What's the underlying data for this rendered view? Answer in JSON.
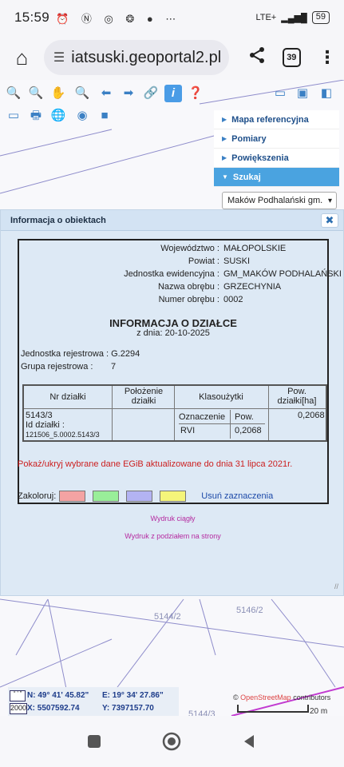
{
  "status_bar": {
    "time": "15:59",
    "battery": "59",
    "network": "LTE+"
  },
  "browser": {
    "url": "iatsuski.geoportal2.pl",
    "tab_count": "39"
  },
  "side_menu": {
    "items": [
      {
        "label": "Mapa referencyjna"
      },
      {
        "label": "Pomiary"
      },
      {
        "label": "Powiększenia"
      },
      {
        "label": "Szukaj"
      }
    ],
    "gmina_select": "Maków Podhalański gm."
  },
  "panel": {
    "title": "Informacja o obiektach",
    "close": "✖"
  },
  "parcel": {
    "fields": [
      {
        "label": "Województwo :",
        "value": "MAŁOPOLSKIE"
      },
      {
        "label": "Powiat :",
        "value": "SUSKI"
      },
      {
        "label": "Jednostka ewidencyjna :",
        "value": "GM_MAKÓW PODHALAŃSKI"
      },
      {
        "label": "Nazwa obrębu :",
        "value": "GRZECHYNIA"
      },
      {
        "label": "Numer obrębu :",
        "value": "0002"
      }
    ],
    "heading": "INFORMACJA O DZIAŁCE",
    "date_line": "z dnia: 20-10-2025",
    "jr_label": "Jednostka rejestrowa :",
    "jr_value": "G.2294",
    "gr_label": "Grupa rejestrowa :",
    "gr_value": "7",
    "table": {
      "headers": {
        "nr": "Nr działki",
        "polozenie": "Położenie działki",
        "klasouzytki": "Klasoużytki",
        "pow": "Pow. działki[ha]"
      },
      "sub_headers": {
        "oznaczenie": "Oznaczenie",
        "pow": "Pow."
      },
      "row": {
        "nr": "5143/3",
        "id_label": "Id działki :",
        "id_value": "121506_5.0002.5143/3",
        "oznaczenie": "RVI",
        "klas_pow": "0,2068",
        "pow": "0,2068"
      }
    },
    "toggle_link": "Pokaż/ukryj wybrane dane EGiB aktualizowane do dnia 31 lipca 2021r.",
    "colorize_label": "Zakoloruj:",
    "swatch_colors": [
      "#f4a3a3",
      "#99ee99",
      "#b3b3f3",
      "#f5f57a"
    ],
    "clear_link": "Usuń zaznaczenia"
  },
  "print_links": {
    "continuous": "Wydruk ciągły",
    "paged": "Wydruk z podziałem na strony"
  },
  "map_labels": [
    "5144/2",
    "5146/2",
    "5144/3"
  ],
  "coords": {
    "n": "N: 49° 41' 45.82\"",
    "e": "E: 19° 34' 27.86\"",
    "x": "X: 5507592.74",
    "y": "Y: 7397157.70",
    "btn_top": "° ' \"",
    "btn_bottom": "2000"
  },
  "attribution": {
    "prefix": "© ",
    "link": "OpenStreetMap",
    "suffix": " contributors"
  },
  "scale_text": "20 m"
}
